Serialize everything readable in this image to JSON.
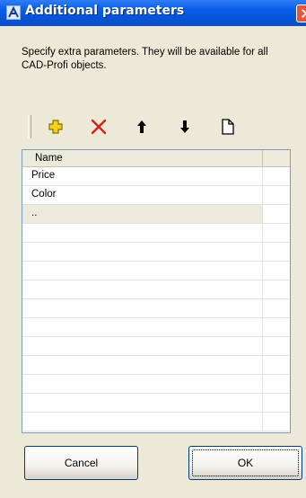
{
  "window": {
    "title": "Additional parameters"
  },
  "description": "Specify extra parameters. They will be available for all CAD-Profi objects.",
  "toolbar": {
    "buttons": [
      {
        "name": "add",
        "icon": "add-icon",
        "color": "#f3d21b"
      },
      {
        "name": "delete",
        "icon": "delete-icon",
        "color": "#d8211b"
      },
      {
        "name": "move-up",
        "icon": "arrow-up-icon",
        "color": "#000000"
      },
      {
        "name": "move-down",
        "icon": "arrow-down-icon",
        "color": "#000000"
      },
      {
        "name": "new-document",
        "icon": "document-icon",
        "color": "#000000"
      }
    ]
  },
  "grid": {
    "column_header": "Name",
    "rows": [
      "Price",
      "Color",
      "..",
      "",
      "",
      "",
      "",
      "",
      "",
      "",
      "",
      "",
      "",
      ""
    ]
  },
  "buttons": {
    "cancel": "Cancel",
    "ok": "OK"
  },
  "colors": {
    "titlebar": "#0a5ee8",
    "dialog_bg": "#ece9d8"
  }
}
